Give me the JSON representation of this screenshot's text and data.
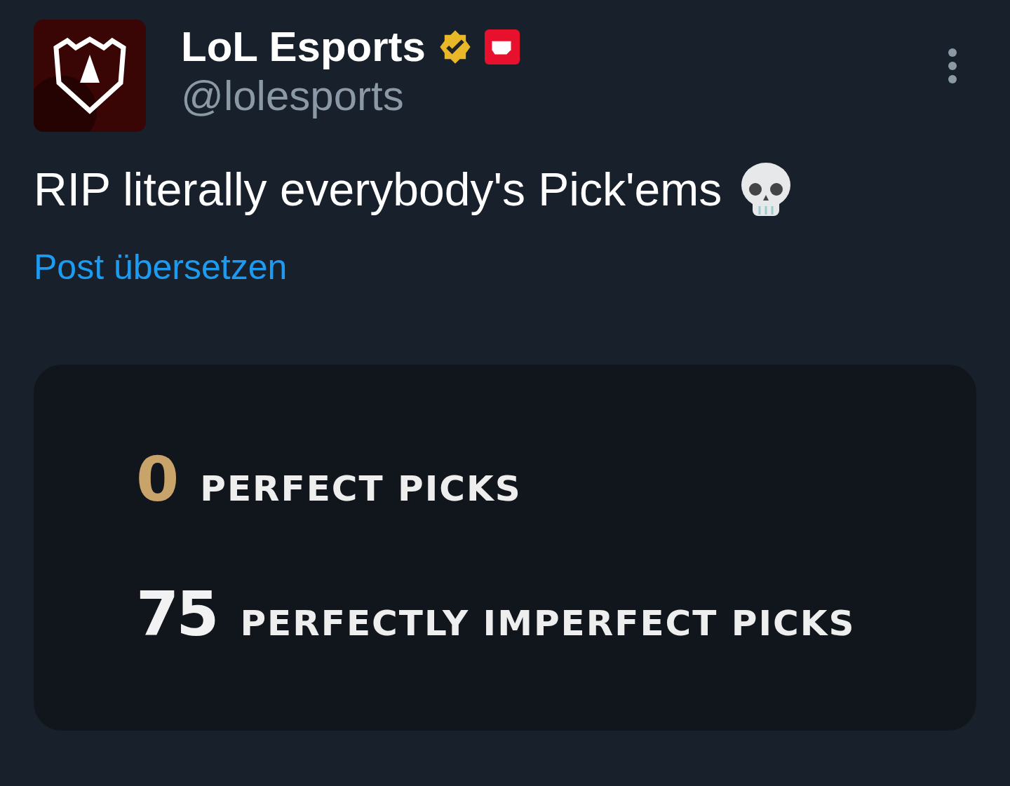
{
  "author": {
    "name": "LoL Esports",
    "handle": "@lolesports",
    "verified": true,
    "affiliate": true
  },
  "post": {
    "text": "RIP literally everybody's Pick'ems",
    "translate_link": "Post übersetzen"
  },
  "media": {
    "stats": [
      {
        "number": "0",
        "label": "PERFECT PICKS",
        "color": "#c9a46a"
      },
      {
        "number": "75",
        "label": "PERFECTLY IMPERFECT PICKS",
        "color": "#f2f2f2"
      }
    ]
  }
}
